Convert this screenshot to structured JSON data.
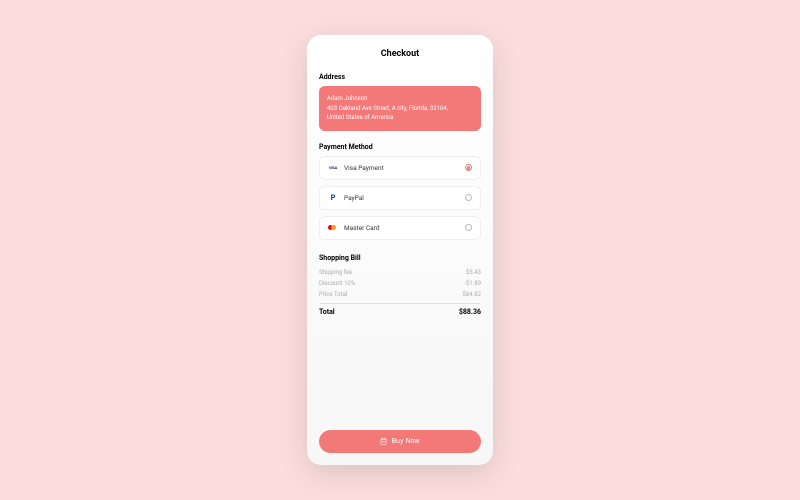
{
  "title": "Checkout",
  "address": {
    "label": "Address",
    "name": "Adam Johnson",
    "street": "403 Oakland Ave Street, A city, Florida, 32104,",
    "country": "United States of America"
  },
  "payment": {
    "label": "Payment Method",
    "options": [
      {
        "label": "Visa Payment",
        "selected": true
      },
      {
        "label": "PayPal",
        "selected": false
      },
      {
        "label": "Master Card",
        "selected": false
      }
    ]
  },
  "bill": {
    "label": "Shopping Bill",
    "rows": [
      {
        "label": "Shipping fee",
        "value": "$5.43"
      },
      {
        "label": "Discount 10%",
        "value": "-$1.89"
      },
      {
        "label": "Price Total",
        "value": "$84.82"
      }
    ],
    "total_label": "Total",
    "total_value": "$88.36"
  },
  "buy_label": "Buy Now"
}
